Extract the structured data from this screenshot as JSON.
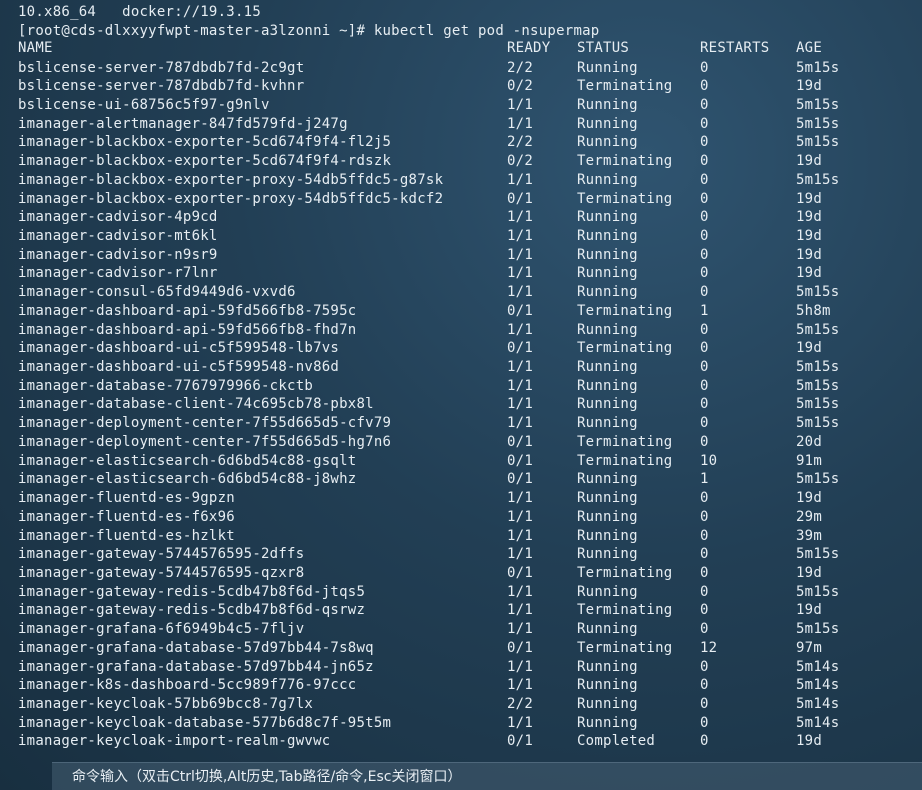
{
  "terminal": {
    "info_line": "10.x86_64   docker://19.3.15",
    "prompt": "[root@cds-dlxxyyfwpt-master-a3lzonni ~]# kubectl get pod -nsupermap",
    "headers": [
      "NAME",
      "READY",
      "STATUS",
      "RESTARTS",
      "AGE"
    ],
    "rows": [
      [
        "bslicense-server-787dbdb7fd-2c9gt",
        "2/2",
        "Running",
        "0",
        "5m15s"
      ],
      [
        "bslicense-server-787dbdb7fd-kvhnr",
        "0/2",
        "Terminating",
        "0",
        "19d"
      ],
      [
        "bslicense-ui-68756c5f97-g9nlv",
        "1/1",
        "Running",
        "0",
        "5m15s"
      ],
      [
        "imanager-alertmanager-847fd579fd-j247g",
        "1/1",
        "Running",
        "0",
        "5m15s"
      ],
      [
        "imanager-blackbox-exporter-5cd674f9f4-fl2j5",
        "2/2",
        "Running",
        "0",
        "5m15s"
      ],
      [
        "imanager-blackbox-exporter-5cd674f9f4-rdszk",
        "0/2",
        "Terminating",
        "0",
        "19d"
      ],
      [
        "imanager-blackbox-exporter-proxy-54db5ffdc5-g87sk",
        "1/1",
        "Running",
        "0",
        "5m15s"
      ],
      [
        "imanager-blackbox-exporter-proxy-54db5ffdc5-kdcf2",
        "0/1",
        "Terminating",
        "0",
        "19d"
      ],
      [
        "imanager-cadvisor-4p9cd",
        "1/1",
        "Running",
        "0",
        "19d"
      ],
      [
        "imanager-cadvisor-mt6kl",
        "1/1",
        "Running",
        "0",
        "19d"
      ],
      [
        "imanager-cadvisor-n9sr9",
        "1/1",
        "Running",
        "0",
        "19d"
      ],
      [
        "imanager-cadvisor-r7lnr",
        "1/1",
        "Running",
        "0",
        "19d"
      ],
      [
        "imanager-consul-65fd9449d6-vxvd6",
        "1/1",
        "Running",
        "0",
        "5m15s"
      ],
      [
        "imanager-dashboard-api-59fd566fb8-7595c",
        "0/1",
        "Terminating",
        "1",
        "5h8m"
      ],
      [
        "imanager-dashboard-api-59fd566fb8-fhd7n",
        "1/1",
        "Running",
        "0",
        "5m15s"
      ],
      [
        "imanager-dashboard-ui-c5f599548-lb7vs",
        "0/1",
        "Terminating",
        "0",
        "19d"
      ],
      [
        "imanager-dashboard-ui-c5f599548-nv86d",
        "1/1",
        "Running",
        "0",
        "5m15s"
      ],
      [
        "imanager-database-7767979966-ckctb",
        "1/1",
        "Running",
        "0",
        "5m15s"
      ],
      [
        "imanager-database-client-74c695cb78-pbx8l",
        "1/1",
        "Running",
        "0",
        "5m15s"
      ],
      [
        "imanager-deployment-center-7f55d665d5-cfv79",
        "1/1",
        "Running",
        "0",
        "5m15s"
      ],
      [
        "imanager-deployment-center-7f55d665d5-hg7n6",
        "0/1",
        "Terminating",
        "0",
        "20d"
      ],
      [
        "imanager-elasticsearch-6d6bd54c88-gsqlt",
        "0/1",
        "Terminating",
        "10",
        "91m"
      ],
      [
        "imanager-elasticsearch-6d6bd54c88-j8whz",
        "0/1",
        "Running",
        "1",
        "5m15s"
      ],
      [
        "imanager-fluentd-es-9gpzn",
        "1/1",
        "Running",
        "0",
        "19d"
      ],
      [
        "imanager-fluentd-es-f6x96",
        "1/1",
        "Running",
        "0",
        "29m"
      ],
      [
        "imanager-fluentd-es-hzlkt",
        "1/1",
        "Running",
        "0",
        "39m"
      ],
      [
        "imanager-gateway-5744576595-2dffs",
        "1/1",
        "Running",
        "0",
        "5m15s"
      ],
      [
        "imanager-gateway-5744576595-qzxr8",
        "0/1",
        "Terminating",
        "0",
        "19d"
      ],
      [
        "imanager-gateway-redis-5cdb47b8f6d-jtqs5",
        "1/1",
        "Running",
        "0",
        "5m15s"
      ],
      [
        "imanager-gateway-redis-5cdb47b8f6d-qsrwz",
        "1/1",
        "Terminating",
        "0",
        "19d"
      ],
      [
        "imanager-grafana-6f6949b4c5-7fljv",
        "1/1",
        "Running",
        "0",
        "5m15s"
      ],
      [
        "imanager-grafana-database-57d97bb44-7s8wq",
        "0/1",
        "Terminating",
        "12",
        "97m"
      ],
      [
        "imanager-grafana-database-57d97bb44-jn65z",
        "1/1",
        "Running",
        "0",
        "5m14s"
      ],
      [
        "imanager-k8s-dashboard-5cc989f776-97ccc",
        "1/1",
        "Running",
        "0",
        "5m14s"
      ],
      [
        "imanager-keycloak-57bb69bcc8-7g7lx",
        "2/2",
        "Running",
        "0",
        "5m14s"
      ],
      [
        "imanager-keycloak-database-577b6d8c7f-95t5m",
        "1/1",
        "Running",
        "0",
        "5m14s"
      ],
      [
        "imanager-keycloak-import-realm-gwvwc",
        "0/1",
        "Completed",
        "0",
        "19d"
      ]
    ]
  },
  "command_bar": {
    "text": "命令输入（双击Ctrl切换,Alt历史,Tab路径/命令,Esc关闭窗口）"
  }
}
